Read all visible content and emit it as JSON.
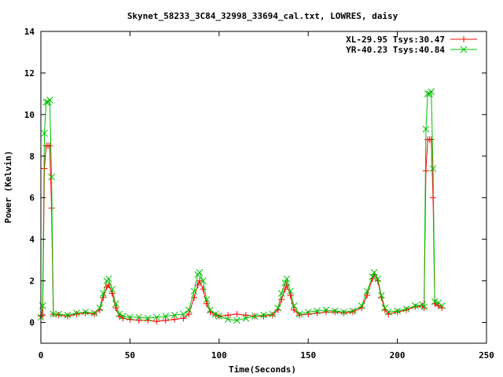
{
  "chart_data": {
    "type": "line",
    "title": "Skynet_58233_3C84_32998_33694_cal.txt, LOWRES, daisy",
    "xlabel": "Time(Seconds)",
    "ylabel": "Power (Kelvin)",
    "xlim": [
      0,
      250
    ],
    "ylim": [
      -1,
      14
    ],
    "xticks": [
      0,
      50,
      100,
      150,
      200,
      250
    ],
    "yticks": [
      0,
      2,
      4,
      6,
      8,
      10,
      12,
      14
    ],
    "grid": false,
    "legend_position": "top-right",
    "series": [
      {
        "name": "XL-29.95 Tsys:30.47",
        "color": "#ff0000",
        "marker": "plus",
        "points": [
          [
            0,
            0.3
          ],
          [
            1,
            0.35
          ],
          [
            2,
            7.4
          ],
          [
            3,
            8.5
          ],
          [
            4,
            8.5
          ],
          [
            5,
            8.5
          ],
          [
            6,
            5.5
          ],
          [
            7,
            0.4
          ],
          [
            10,
            0.35
          ],
          [
            15,
            0.3
          ],
          [
            20,
            0.4
          ],
          [
            25,
            0.45
          ],
          [
            30,
            0.4
          ],
          [
            33,
            0.6
          ],
          [
            35,
            1.2
          ],
          [
            37,
            1.7
          ],
          [
            38,
            1.8
          ],
          [
            40,
            1.4
          ],
          [
            42,
            0.7
          ],
          [
            44,
            0.3
          ],
          [
            46,
            0.2
          ],
          [
            50,
            0.15
          ],
          [
            55,
            0.1
          ],
          [
            60,
            0.1
          ],
          [
            65,
            0.05
          ],
          [
            70,
            0.1
          ],
          [
            75,
            0.15
          ],
          [
            80,
            0.2
          ],
          [
            83,
            0.4
          ],
          [
            86,
            1.2
          ],
          [
            88,
            1.8
          ],
          [
            89,
            2.0
          ],
          [
            91,
            1.6
          ],
          [
            93,
            0.9
          ],
          [
            95,
            0.5
          ],
          [
            98,
            0.35
          ],
          [
            100,
            0.3
          ],
          [
            105,
            0.35
          ],
          [
            110,
            0.4
          ],
          [
            115,
            0.35
          ],
          [
            120,
            0.3
          ],
          [
            125,
            0.3
          ],
          [
            130,
            0.35
          ],
          [
            133,
            0.6
          ],
          [
            135,
            1.1
          ],
          [
            137,
            1.6
          ],
          [
            138,
            1.8
          ],
          [
            140,
            1.3
          ],
          [
            142,
            0.6
          ],
          [
            145,
            0.35
          ],
          [
            150,
            0.4
          ],
          [
            155,
            0.45
          ],
          [
            160,
            0.5
          ],
          [
            165,
            0.5
          ],
          [
            170,
            0.45
          ],
          [
            175,
            0.5
          ],
          [
            180,
            0.7
          ],
          [
            183,
            1.3
          ],
          [
            186,
            2.1
          ],
          [
            187,
            2.3
          ],
          [
            189,
            2.0
          ],
          [
            191,
            1.2
          ],
          [
            193,
            0.6
          ],
          [
            195,
            0.4
          ],
          [
            200,
            0.5
          ],
          [
            205,
            0.6
          ],
          [
            210,
            0.75
          ],
          [
            214,
            0.8
          ],
          [
            215,
            0.7
          ],
          [
            216,
            7.3
          ],
          [
            217,
            8.8
          ],
          [
            218,
            8.8
          ],
          [
            219,
            8.8
          ],
          [
            220,
            6.0
          ],
          [
            221,
            0.9
          ],
          [
            223,
            0.8
          ],
          [
            225,
            0.7
          ]
        ]
      },
      {
        "name": "YR-40.23 Tsys:40.84",
        "color": "#00c000",
        "marker": "cross",
        "points": [
          [
            0,
            0.25
          ],
          [
            1,
            0.8
          ],
          [
            2,
            9.1
          ],
          [
            3,
            10.6
          ],
          [
            4,
            10.6
          ],
          [
            5,
            10.7
          ],
          [
            6,
            7.0
          ],
          [
            7,
            0.4
          ],
          [
            10,
            0.4
          ],
          [
            15,
            0.35
          ],
          [
            20,
            0.45
          ],
          [
            25,
            0.5
          ],
          [
            30,
            0.45
          ],
          [
            33,
            0.7
          ],
          [
            35,
            1.4
          ],
          [
            37,
            2.0
          ],
          [
            38,
            2.1
          ],
          [
            40,
            1.6
          ],
          [
            42,
            0.9
          ],
          [
            44,
            0.4
          ],
          [
            46,
            0.3
          ],
          [
            50,
            0.25
          ],
          [
            55,
            0.25
          ],
          [
            60,
            0.2
          ],
          [
            65,
            0.25
          ],
          [
            70,
            0.3
          ],
          [
            75,
            0.35
          ],
          [
            80,
            0.4
          ],
          [
            83,
            0.6
          ],
          [
            86,
            1.5
          ],
          [
            88,
            2.3
          ],
          [
            89,
            2.4
          ],
          [
            91,
            2.0
          ],
          [
            93,
            1.1
          ],
          [
            95,
            0.6
          ],
          [
            98,
            0.4
          ],
          [
            100,
            0.3
          ],
          [
            105,
            0.15
          ],
          [
            110,
            0.1
          ],
          [
            115,
            0.2
          ],
          [
            120,
            0.3
          ],
          [
            125,
            0.35
          ],
          [
            130,
            0.4
          ],
          [
            133,
            0.7
          ],
          [
            135,
            1.4
          ],
          [
            137,
            1.9
          ],
          [
            138,
            2.1
          ],
          [
            140,
            1.5
          ],
          [
            142,
            0.8
          ],
          [
            145,
            0.4
          ],
          [
            150,
            0.5
          ],
          [
            155,
            0.55
          ],
          [
            160,
            0.6
          ],
          [
            165,
            0.55
          ],
          [
            170,
            0.5
          ],
          [
            175,
            0.55
          ],
          [
            180,
            0.8
          ],
          [
            183,
            1.5
          ],
          [
            186,
            2.2
          ],
          [
            187,
            2.4
          ],
          [
            189,
            2.1
          ],
          [
            191,
            1.3
          ],
          [
            193,
            0.7
          ],
          [
            195,
            0.5
          ],
          [
            200,
            0.55
          ],
          [
            205,
            0.65
          ],
          [
            210,
            0.8
          ],
          [
            214,
            0.85
          ],
          [
            215,
            0.75
          ],
          [
            216,
            9.3
          ],
          [
            217,
            11.0
          ],
          [
            218,
            11.0
          ],
          [
            219,
            11.1
          ],
          [
            220,
            7.4
          ],
          [
            221,
            1.0
          ],
          [
            223,
            0.95
          ],
          [
            225,
            0.8
          ]
        ]
      }
    ]
  }
}
